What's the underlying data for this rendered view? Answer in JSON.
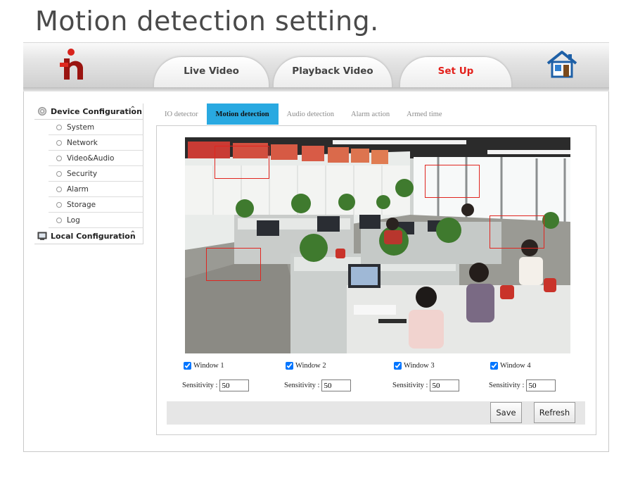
{
  "page_heading": "Motion detection setting.",
  "header": {
    "tabs": [
      {
        "label": "Live Video"
      },
      {
        "label": "Playback Video"
      },
      {
        "label": "Set Up",
        "active": true
      }
    ],
    "accent_color": "#e3201b"
  },
  "sidebar": {
    "groups": [
      {
        "label": "Device Configuration",
        "expanded": true,
        "items": [
          "System",
          "Network",
          "Video&Audio",
          "Security",
          "Alarm",
          "Storage",
          "Log"
        ]
      },
      {
        "label": "Local Configuration",
        "expanded": true
      }
    ]
  },
  "subtabs": {
    "items": [
      "IO detector",
      "Motion detection",
      "Audio detection",
      "Alarm action",
      "Armed time"
    ],
    "active_index": 1,
    "active_color": "#29a9e1"
  },
  "video": {
    "icon": "camera-feed",
    "window_color": "#e0251f"
  },
  "windows": [
    {
      "label": "Window 1",
      "checked": true,
      "sensitivity_label": "Sensitivity :",
      "sensitivity": "50"
    },
    {
      "label": "Window 2",
      "checked": true,
      "sensitivity_label": "Sensitivity :",
      "sensitivity": "50"
    },
    {
      "label": "Window 3",
      "checked": true,
      "sensitivity_label": "Sensitivity :",
      "sensitivity": "50"
    },
    {
      "label": "Window 4",
      "checked": true,
      "sensitivity_label": "Sensitivity :",
      "sensitivity": "50"
    }
  ],
  "actions": {
    "save": "Save",
    "refresh": "Refresh"
  }
}
